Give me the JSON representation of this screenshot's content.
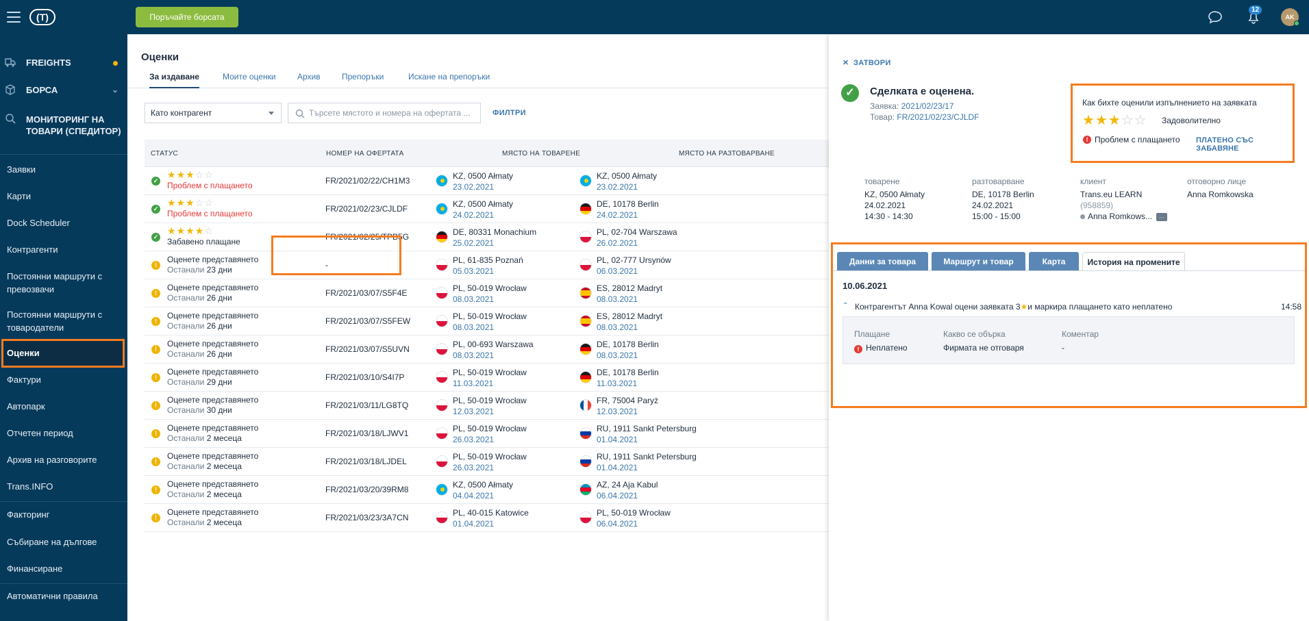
{
  "topbar": {
    "logo": "(T)",
    "cta": "Поръчайте борсата",
    "notifications_count": "12",
    "avatar_initials": "AK"
  },
  "sidebar": {
    "main": [
      {
        "label": "FREIGHTS",
        "icon": "freights-icon"
      },
      {
        "label": "БОРСА",
        "icon": "exchange-icon"
      },
      {
        "label": "МОНИТОРИНГ НА ТОВАРИ (СПЕДИТОР)",
        "icon": "monitoring-icon"
      }
    ],
    "items": [
      "Заявки",
      "Карти",
      "Dock Scheduler",
      "Контрагенти",
      "Постоянни маршрути с превозвачи",
      "Постоянни маршрути с товародатели",
      "Оценки",
      "Фактури",
      "Автопарк",
      "Отчетен период",
      "Архив на разговорите",
      "Trans.INFO",
      "Факторинг",
      "Събиране на дългове",
      "Финансиране",
      "Автоматични правила"
    ],
    "active_item": "Оценки"
  },
  "main": {
    "title": "Оценки",
    "tabs": [
      "За издаване",
      "Моите оценки",
      "Архив",
      "Препоръки",
      "Искане на препоръки"
    ],
    "active_tab": "За издаване",
    "filter_select": "Като контрагент",
    "search_placeholder": "Търсете мястото и номера на офертата ...",
    "filters_link": "ФИЛТРИ",
    "columns": [
      "СТАТУС",
      "НОМЕР НА ОФЕРТАТА",
      "МЯСТО НА ТОВАРЕНЕ",
      "МЯСТО НА РАЗТОВАРВАНЕ"
    ],
    "rows": [
      {
        "status": "ok",
        "stars": 3,
        "s1": "",
        "s2": "Проблем с плащането",
        "s2_red": true,
        "offer": "FR/2021/02/22/CH1M3",
        "load": {
          "place": "KZ, 0500 Ałmaty",
          "date": "23.02.2021",
          "flag": "kz"
        },
        "unload": {
          "place": "KZ, 0500 Ałmaty",
          "date": "23.02.2021",
          "flag": "kz"
        }
      },
      {
        "status": "ok",
        "stars": 3,
        "s1": "",
        "s2": "Проблем с плащането",
        "s2_red": true,
        "offer": "FR/2021/02/23/CJLDF",
        "load": {
          "place": "KZ, 0500 Ałmaty",
          "date": "24.02.2021",
          "flag": "kz"
        },
        "unload": {
          "place": "DE, 10178 Berlin",
          "date": "24.02.2021",
          "flag": "de"
        }
      },
      {
        "status": "ok",
        "stars": 4,
        "s1": "",
        "s2": "Забавено плащане",
        "s2_red": false,
        "offer": "FR/2021/02/25/TPB5G",
        "load": {
          "place": "DE, 80331 Monachium",
          "date": "25.02.2021",
          "flag": "de"
        },
        "unload": {
          "place": "PL, 02-704 Warszawa",
          "date": "26.02.2021",
          "flag": "pl"
        }
      },
      {
        "status": "warn",
        "stars": 0,
        "s1": "Оценете представянето",
        "s2_prefix": "Останали",
        "s2": "23 дни",
        "offer": "-",
        "load": {
          "place": "PL, 61-835 Poznań",
          "date": "05.03.2021",
          "flag": "pl"
        },
        "unload": {
          "place": "PL, 02-777 Ursynów",
          "date": "06.03.2021",
          "flag": "pl"
        }
      },
      {
        "status": "warn",
        "stars": 0,
        "s1": "Оценете представянето",
        "s2_prefix": "Останали",
        "s2": "26 дни",
        "offer": "FR/2021/03/07/S5F4E",
        "load": {
          "place": "PL, 50-019 Wrocław",
          "date": "08.03.2021",
          "flag": "pl"
        },
        "unload": {
          "place": "ES, 28012 Madryt",
          "date": "08.03.2021",
          "flag": "es"
        }
      },
      {
        "status": "warn",
        "stars": 0,
        "s1": "Оценете представянето",
        "s2_prefix": "Останали",
        "s2": "26 дни",
        "offer": "FR/2021/03/07/S5FEW",
        "load": {
          "place": "PL, 50-019 Wrocław",
          "date": "08.03.2021",
          "flag": "pl"
        },
        "unload": {
          "place": "ES, 28012 Madryt",
          "date": "08.03.2021",
          "flag": "es"
        }
      },
      {
        "status": "warn",
        "stars": 0,
        "s1": "Оценете представянето",
        "s2_prefix": "Останали",
        "s2": "26 дни",
        "offer": "FR/2021/03/07/S5UVN",
        "load": {
          "place": "PL, 00-693 Warszawa",
          "date": "08.03.2021",
          "flag": "pl"
        },
        "unload": {
          "place": "DE, 10178 Berlin",
          "date": "08.03.2021",
          "flag": "de"
        }
      },
      {
        "status": "warn",
        "stars": 0,
        "s1": "Оценете представянето",
        "s2_prefix": "Останали",
        "s2": "29 дни",
        "offer": "FR/2021/03/10/S4I7P",
        "load": {
          "place": "PL, 50-019 Wrocław",
          "date": "11.03.2021",
          "flag": "pl"
        },
        "unload": {
          "place": "DE, 10178 Berlin",
          "date": "11.03.2021",
          "flag": "de"
        }
      },
      {
        "status": "warn",
        "stars": 0,
        "s1": "Оценете представянето",
        "s2_prefix": "Останали",
        "s2": "30 дни",
        "offer": "FR/2021/03/11/LG8TQ",
        "load": {
          "place": "PL, 50-019 Wrocław",
          "date": "12.03.2021",
          "flag": "pl"
        },
        "unload": {
          "place": "FR, 75004 Paryż",
          "date": "12.03.2021",
          "flag": "fr"
        }
      },
      {
        "status": "warn",
        "stars": 0,
        "s1": "Оценете представянето",
        "s2_prefix": "Останали",
        "s2": "2 месеца",
        "offer": "FR/2021/03/18/LJWV1",
        "load": {
          "place": "PL, 50-019 Wrocław",
          "date": "26.03.2021",
          "flag": "pl"
        },
        "unload": {
          "place": "RU, 1911 Sankt Petersburg",
          "date": "01.04.2021",
          "flag": "ru"
        }
      },
      {
        "status": "warn",
        "stars": 0,
        "s1": "Оценете представянето",
        "s2_prefix": "Останали",
        "s2": "2 месеца",
        "offer": "FR/2021/03/18/LJDEL",
        "load": {
          "place": "PL, 50-019 Wrocław",
          "date": "26.03.2021",
          "flag": "pl"
        },
        "unload": {
          "place": "RU, 1911 Sankt Petersburg",
          "date": "01.04.2021",
          "flag": "ru"
        }
      },
      {
        "status": "warn",
        "stars": 0,
        "s1": "Оценете представянето",
        "s2_prefix": "Останали",
        "s2": "2 месеца",
        "offer": "FR/2021/03/20/39RM8",
        "load": {
          "place": "KZ, 0500 Ałmaty",
          "date": "04.04.2021",
          "flag": "kz"
        },
        "unload": {
          "place": "AZ, 24 Aja Kabul",
          "date": "06.04.2021",
          "flag": "az"
        }
      },
      {
        "status": "warn",
        "stars": 0,
        "s1": "Оценете представянето",
        "s2_prefix": "Останали",
        "s2": "2 месеца",
        "offer": "FR/2021/03/23/3A7CN",
        "load": {
          "place": "PL, 40-015 Katowice",
          "date": "01.04.2021",
          "flag": "pl"
        },
        "unload": {
          "place": "PL, 50-019 Wrocław",
          "date": "06.04.2021",
          "flag": "pl"
        }
      }
    ]
  },
  "panel": {
    "close_label": "ЗАТВОРИ",
    "deal_title": "Сделката е оценена.",
    "order_label": "Заявка:",
    "order_value": "2021/02/23/17",
    "cargo_label": "Товар:",
    "cargo_value": "FR/2021/02/23/CJLDF",
    "rating": {
      "question": "Как бихте оценили изпълнението на заявката",
      "stars": 3,
      "word": "Задоволително",
      "problem": "Проблем с плащането",
      "link": "ПЛАТЕНО СЪС ЗАБАВЯНЕ"
    },
    "info": {
      "loading_label": "товарене",
      "loading_place": "KZ, 0500 Ałmaty",
      "loading_date": "24.02.2021",
      "loading_time": "14:30 - 14:30",
      "unloading_label": "разтоварване",
      "unloading_place": "DE, 10178 Berlin",
      "unloading_date": "24.02.2021",
      "unloading_time": "15:00 - 15:00",
      "client_label": "клиент",
      "client_name": "Trans.eu LEARN",
      "client_id": "(958859)",
      "client_person": "Anna Romkows...",
      "responsible_label": "отговорно лице",
      "responsible_name": "Anna Romkowska"
    },
    "tabs": [
      "Данни за товара",
      "Маршрут и товар",
      "Карта",
      "История на промените"
    ],
    "active_tab": "История на промените",
    "history": {
      "date": "10.06.2021",
      "text_before": "Контрагентът Anna Kowal оцени заявката 3",
      "text_after": "и маркира плащането като неплатено",
      "time": "14:58",
      "payment_label": "Плащане",
      "payment_value": "Неплатено",
      "issue_label": "Какво се обърка",
      "issue_value": "Фирмата не отговаря",
      "comment_label": "Коментар",
      "comment_value": "-"
    }
  },
  "colors": {
    "navy": "#063a5b",
    "accent_orange": "#f57c20",
    "cta_green": "#8cbc3f",
    "link_blue": "#3b76ad",
    "star_yellow": "#f2b705",
    "error_red": "#e53935",
    "ok_green": "#43a047"
  }
}
